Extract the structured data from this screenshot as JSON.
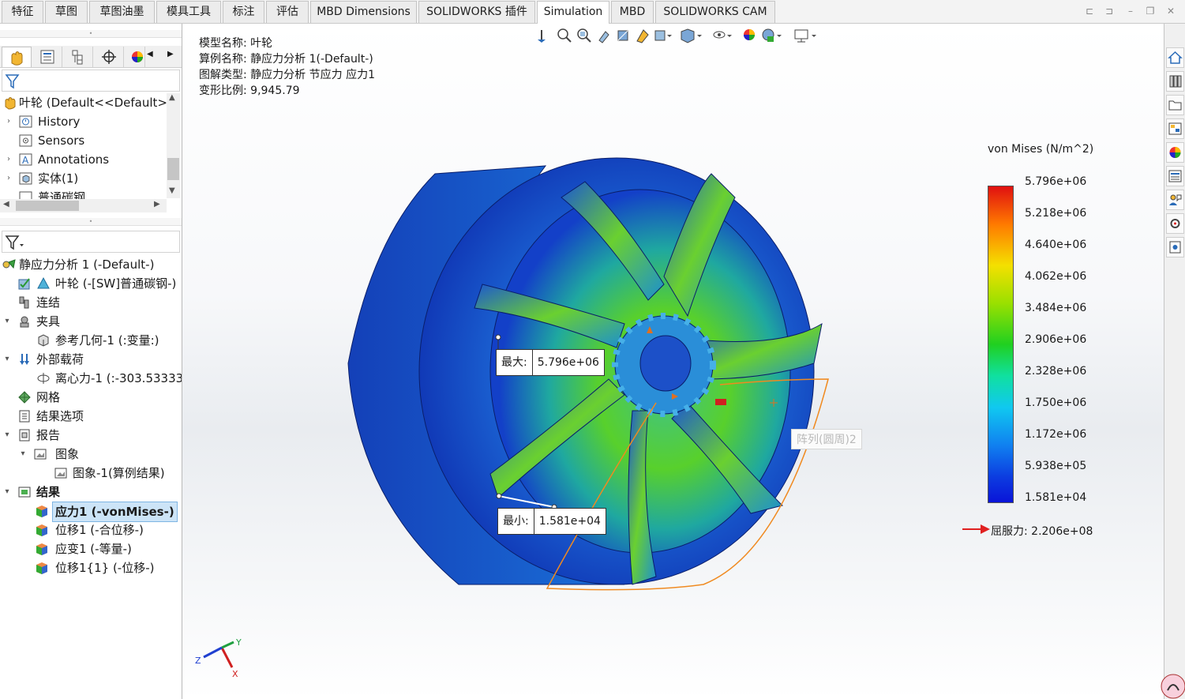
{
  "tabs": [
    {
      "label": "特征",
      "active": false
    },
    {
      "label": "草图",
      "active": false
    },
    {
      "label": "草图油墨",
      "active": false
    },
    {
      "label": "模具工具",
      "active": false
    },
    {
      "label": "标注",
      "active": false
    },
    {
      "label": "评估",
      "active": false
    },
    {
      "label": "MBD Dimensions",
      "active": false
    },
    {
      "label": "SOLIDWORKS 插件",
      "active": false
    },
    {
      "label": "Simulation",
      "active": true
    },
    {
      "label": "MBD",
      "active": false
    },
    {
      "label": "SOLIDWORKS CAM",
      "active": false
    }
  ],
  "feature_tree": {
    "root": "叶轮  (Default<<Default>_",
    "items": [
      "History",
      "Sensors",
      "Annotations",
      "实体(1)",
      "普通碳钢"
    ]
  },
  "sim_tree": {
    "study": "静应力分析 1 (-Default-)",
    "part": "叶轮 (-[SW]普通碳钢-)",
    "connections": "连结",
    "fixtures": "夹具",
    "fixture_item": "参考几何-1 (:变量:)",
    "loads": "外部载荷",
    "load_item": "离心力-1 (:-303.533333",
    "mesh": "网格",
    "result_options": "结果选项",
    "report": "报告",
    "images": "图象",
    "image_item": "图象-1(算例结果)",
    "results": "结果",
    "result_items": [
      "应力1 (-vonMises-)",
      "位移1 (-合位移-)",
      "应变1 (-等量-)",
      "位移1{1} (-位移-)"
    ]
  },
  "model_info": {
    "model_name": "模型名称: 叶轮",
    "study_name": "算例名称: 静应力分析 1(-Default-)",
    "plot_type": "图解类型: 静应力分析 节应力 应力1",
    "deformation": "变形比例: 9,945.79"
  },
  "legend": {
    "title": "von Mises (N/m^2)",
    "ticks": [
      "5.796e+06",
      "5.218e+06",
      "4.640e+06",
      "4.062e+06",
      "3.484e+06",
      "2.906e+06",
      "2.328e+06",
      "1.750e+06",
      "1.172e+06",
      "5.938e+05",
      "1.581e+04"
    ],
    "yield": "屈服力: 2.206e+08"
  },
  "callouts": {
    "max_key": "最大:",
    "max_val": "5.796e+06",
    "min_key": "最小:",
    "min_val": "1.581e+04"
  },
  "pattern_tooltip": "阵列(圆周)2",
  "triad": {
    "x": "X",
    "y": "Y",
    "z": "Z"
  },
  "colors": {
    "accent": "#1f6fc5",
    "arrow": "#e02020",
    "highlight": "#cce4f7"
  }
}
